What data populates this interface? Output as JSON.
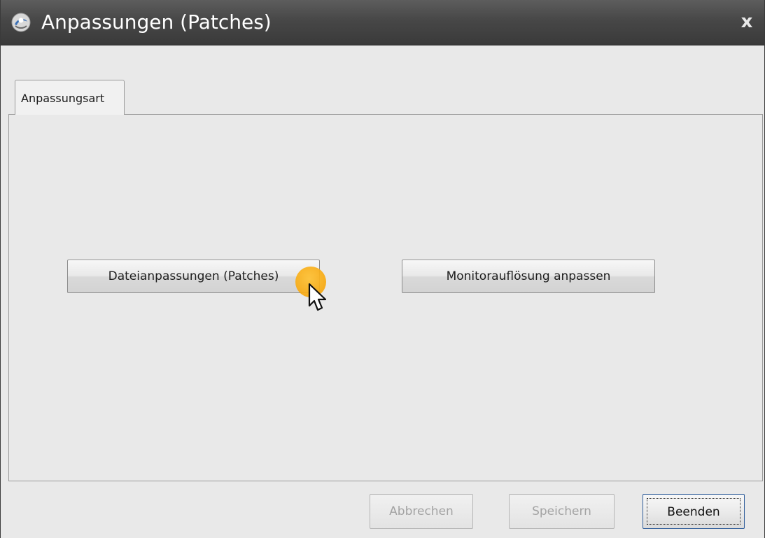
{
  "window": {
    "title": "Anpassungen (Patches)",
    "close_glyph": "x",
    "app_icon": "app-logo-icon"
  },
  "tabs": [
    {
      "label": "Anpassungsart",
      "active": true
    }
  ],
  "main": {
    "patch_button_label": "Dateianpassungen (Patches)",
    "monitor_button_label": "Monitorauflösung anpassen"
  },
  "footer": {
    "cancel_label": "Abbrechen",
    "save_label": "Speichern",
    "quit_label": "Beenden"
  },
  "colors": {
    "titlebar": "#474747",
    "background": "#e9e9e9",
    "cursor_highlight": "#f7a80f",
    "focus_border": "#2f5d9a"
  }
}
